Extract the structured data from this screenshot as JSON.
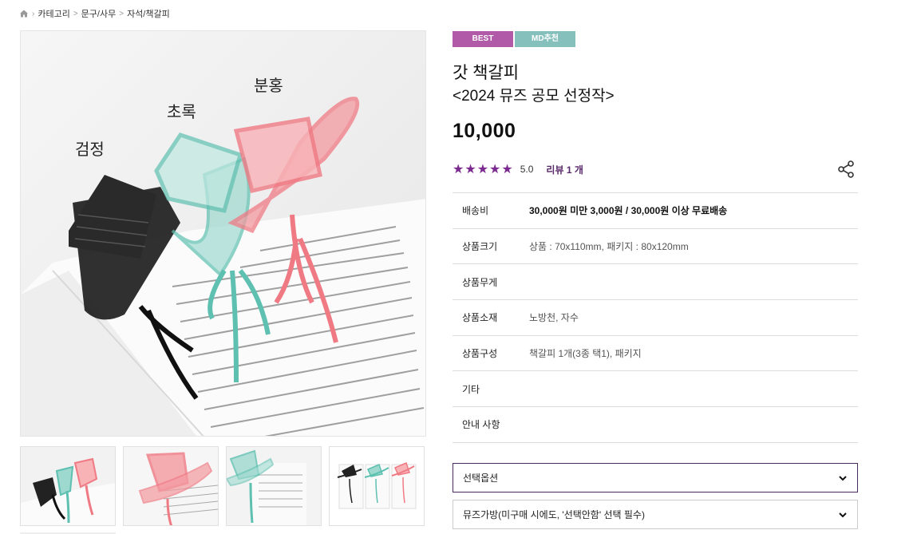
{
  "breadcrumb": {
    "items": [
      "카테고리",
      "문구/사무",
      "자석/책갈피"
    ],
    "separator": ">"
  },
  "product": {
    "badges": [
      {
        "label": "BEST",
        "color": "#b05aa8"
      },
      {
        "label": "MD추천",
        "color": "#86c0bd"
      }
    ],
    "title": "갓 책갈피",
    "subtitle": "<2024 뮤즈 공모 선정작>",
    "price": "10,000",
    "stars": "★★★★★",
    "rating": "5.0",
    "review_label": "리뷰 1 개",
    "accent_color": "#7b2a8f"
  },
  "image_labels": {
    "black": "검정",
    "green": "초록",
    "pink": "분홍"
  },
  "info": [
    {
      "key": "배송비",
      "value": "30,000원 미만 3,000원 / 30,000원 이상 무료배송"
    },
    {
      "key": "상품크기",
      "value": "상품 : 70x110mm, 패키지 : 80x120mm"
    },
    {
      "key": "상품무게",
      "value": ""
    },
    {
      "key": "상품소재",
      "value": "노방천, 자수"
    },
    {
      "key": "상품구성",
      "value": "책갈피 1개(3종 택1), 패키지"
    },
    {
      "key": "기타",
      "value": ""
    },
    {
      "key": "안내 사항",
      "value": ""
    }
  ],
  "options": {
    "select1": "선택옵션",
    "select2": "뮤즈가방(미구매 시에도, '선택안함' 선택 필수)"
  },
  "icons": {
    "home": "home-icon",
    "share": "share-icon",
    "chevron": "chevron-down-icon"
  }
}
